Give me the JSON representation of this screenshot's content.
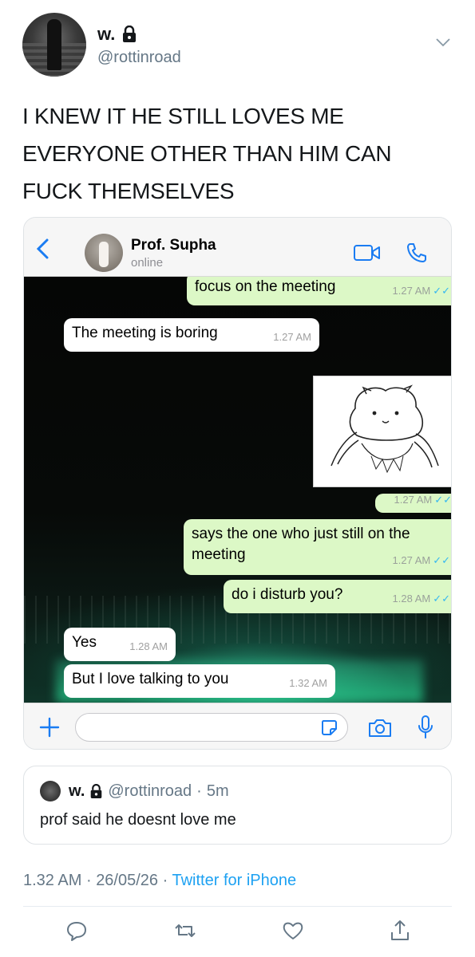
{
  "author": {
    "display_name": "w.",
    "handle": "@rottinroad"
  },
  "tweet": {
    "text_lines": [
      "I KNEW IT HE STILL LOVES ME",
      "EVERYONE OTHER THAN HIM CAN",
      "FUCK THEMSELVES"
    ]
  },
  "whatsapp": {
    "contact_name": "Prof. Supha",
    "contact_status": "online",
    "messages": [
      {
        "dir": "out",
        "text": "focus on the meeting",
        "time": "1.27 AM"
      },
      {
        "dir": "in",
        "text": "The meeting is boring",
        "time": "1.27 AM"
      },
      {
        "dir": "out",
        "text": "",
        "time": "1.27 AM",
        "sticker": true
      },
      {
        "dir": "out",
        "text": "says the one who just still on the meeting",
        "time": "1.27 AM"
      },
      {
        "dir": "out",
        "text": "do i disturb you?",
        "time": "1.28 AM"
      },
      {
        "dir": "in",
        "text": "Yes",
        "time": "1.28 AM"
      },
      {
        "dir": "in",
        "text": "But I love talking to you",
        "time": "1.32 AM"
      }
    ],
    "accent_green": "#dcf8c6",
    "icons": [
      "back-icon",
      "video-call-icon",
      "phone-icon",
      "plus-icon",
      "sticker-icon",
      "camera-icon",
      "mic-icon"
    ]
  },
  "quote": {
    "display_name": "w.",
    "handle": "@rottinroad",
    "separator": "·",
    "age": "5m",
    "text": "prof said he doesnt love me"
  },
  "meta": {
    "time": "1.32 AM",
    "separator": "·",
    "date": "26/05/26",
    "source": "Twitter for iPhone"
  },
  "actions": [
    "reply-icon",
    "retweet-icon",
    "like-icon",
    "share-icon"
  ],
  "colors": {
    "link": "#1da1f2",
    "muted": "#657786",
    "read_ticks": "#34b7f1"
  }
}
